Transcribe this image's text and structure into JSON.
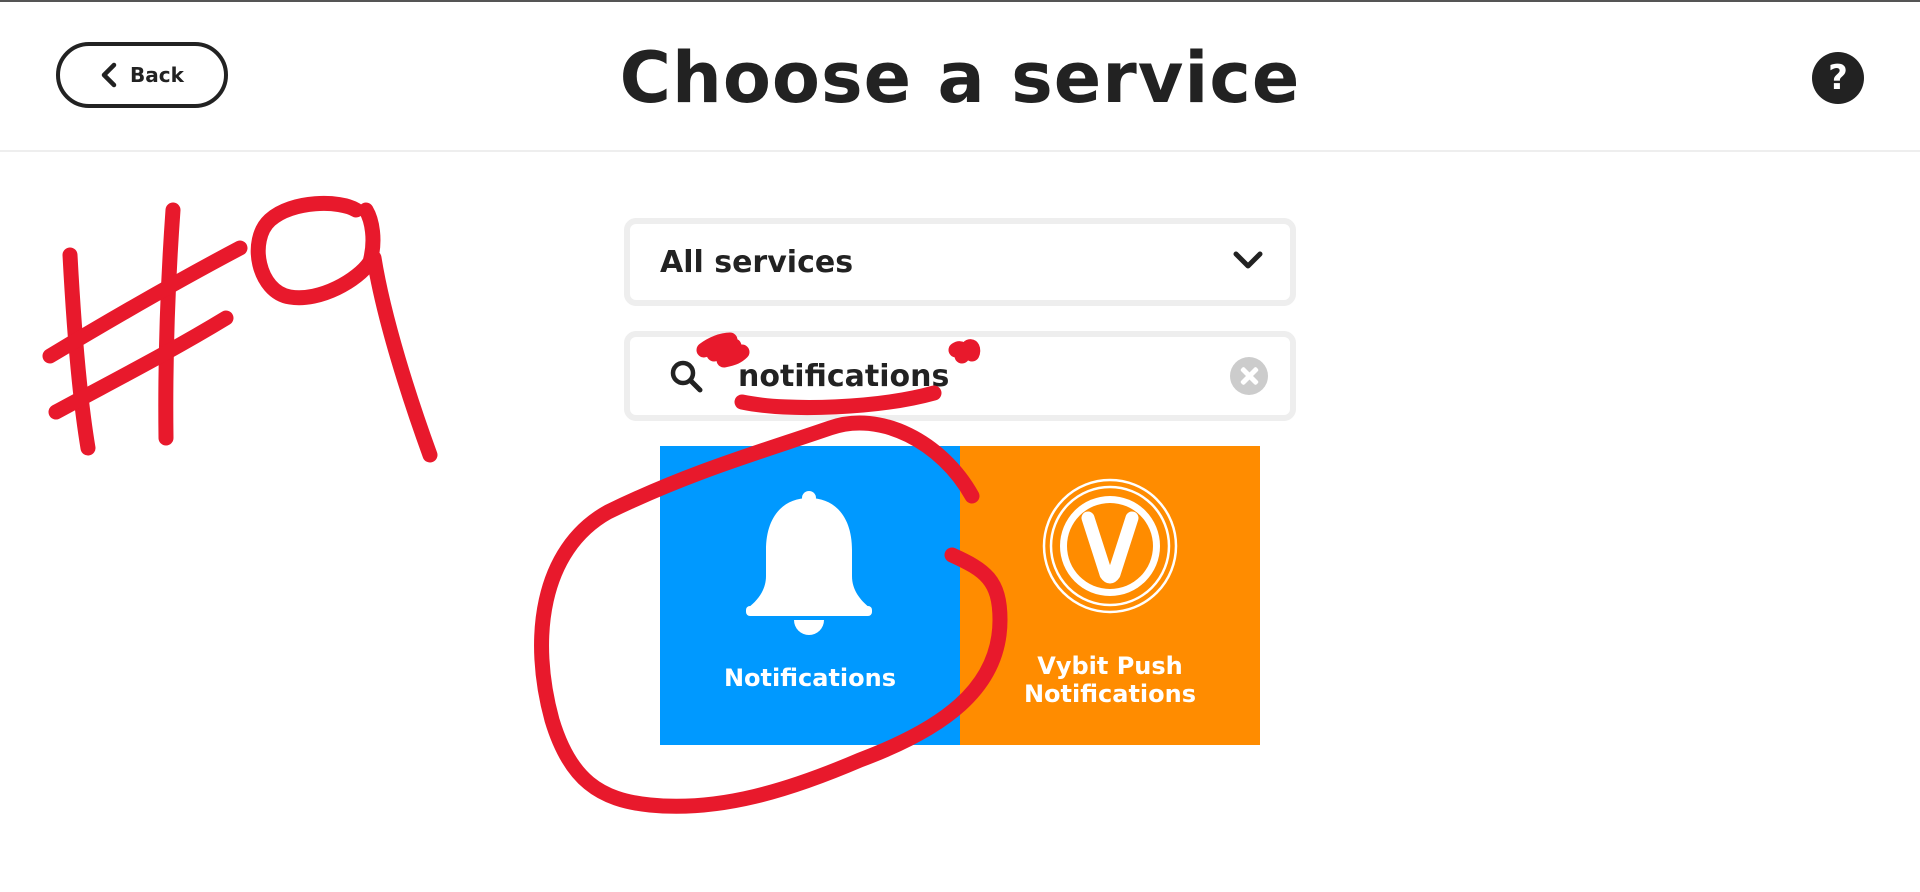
{
  "header": {
    "back_label": "Back",
    "title": "Choose a service",
    "help_label": "?"
  },
  "filter": {
    "selected": "All services"
  },
  "search": {
    "value": "notifications"
  },
  "services": [
    {
      "name": "Notifications",
      "color": "#0099ff",
      "icon": "bell-icon"
    },
    {
      "name": "Vybit Push\nNotifications",
      "color": "#ff8c00",
      "icon": "vybit-logo-icon"
    }
  ],
  "annotation": {
    "step_label": "#9",
    "color": "#e8192c"
  }
}
